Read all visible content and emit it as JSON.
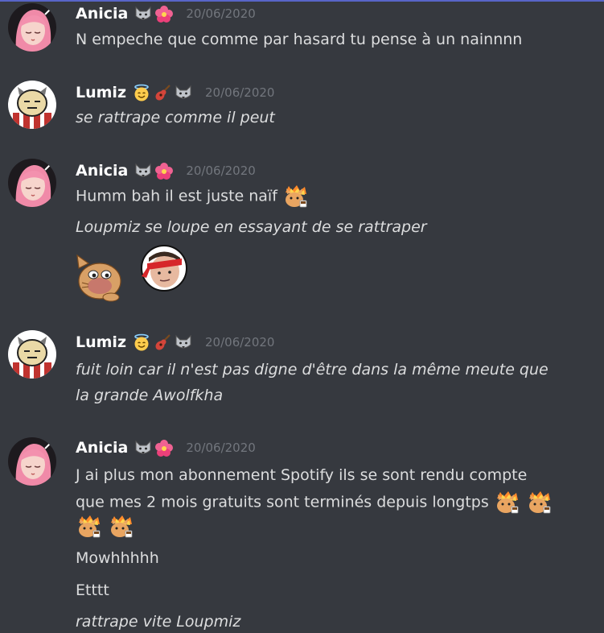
{
  "colors": {
    "background": "#36393f",
    "username": "#ffffff",
    "text": "#dcddde",
    "timestamp": "#72767d",
    "accent_line": "#5865c8"
  },
  "messages": [
    {
      "username": "Anicia",
      "badges": [
        "wolf-emoji",
        "hibiscus-emoji"
      ],
      "timestamp": "20/06/2020",
      "lines": [
        {
          "text": "N empeche que comme par hasard tu pense à un nainnnn",
          "italic": false
        }
      ]
    },
    {
      "username": "Lumiz",
      "badges": [
        "angel-smiley-emoji",
        "guitar-emoji",
        "wolf-emoji"
      ],
      "timestamp": "20/06/2020",
      "lines": [
        {
          "text": "se rattrape comme il peut",
          "italic": true
        }
      ]
    },
    {
      "username": "Anicia",
      "badges": [
        "wolf-emoji",
        "hibiscus-emoji"
      ],
      "timestamp": "20/06/2020",
      "lines": [
        {
          "text": "Humm bah il est juste naïf",
          "italic": false,
          "emoji": "cat-fire-emoji"
        },
        {
          "text": "Loupmiz se loupe en essayant de se rattraper",
          "italic": true
        }
      ],
      "big_emojis": [
        "cat-pepe-emoji",
        "headband-man-emoji"
      ]
    },
    {
      "username": "Lumiz",
      "badges": [
        "angel-smiley-emoji",
        "guitar-emoji",
        "wolf-emoji"
      ],
      "timestamp": "20/06/2020",
      "lines": [
        {
          "text": "fuit loin car il n'est pas digne d'être dans la même meute que",
          "italic": true
        },
        {
          "text": "la grande Awolfkha",
          "italic": true
        }
      ]
    },
    {
      "username": "Anicia",
      "badges": [
        "wolf-emoji",
        "hibiscus-emoji"
      ],
      "timestamp": "20/06/2020",
      "lines": [
        {
          "text": "J ai plus mon abonnement Spotify ils se sont rendu compte",
          "italic": false
        },
        {
          "text": "que mes 2 mois gratuits sont terminés depuis longtps",
          "italic": false,
          "emoji": "cat-fire-emoji x2"
        },
        {
          "text": "",
          "italic": false,
          "emoji": "cat-fire-emoji x2"
        },
        {
          "text": "Mowhhhhh",
          "italic": false
        },
        {
          "text": "Etttt",
          "italic": false
        },
        {
          "text": "rattrape vite Loupmiz",
          "italic": true
        }
      ]
    }
  ]
}
